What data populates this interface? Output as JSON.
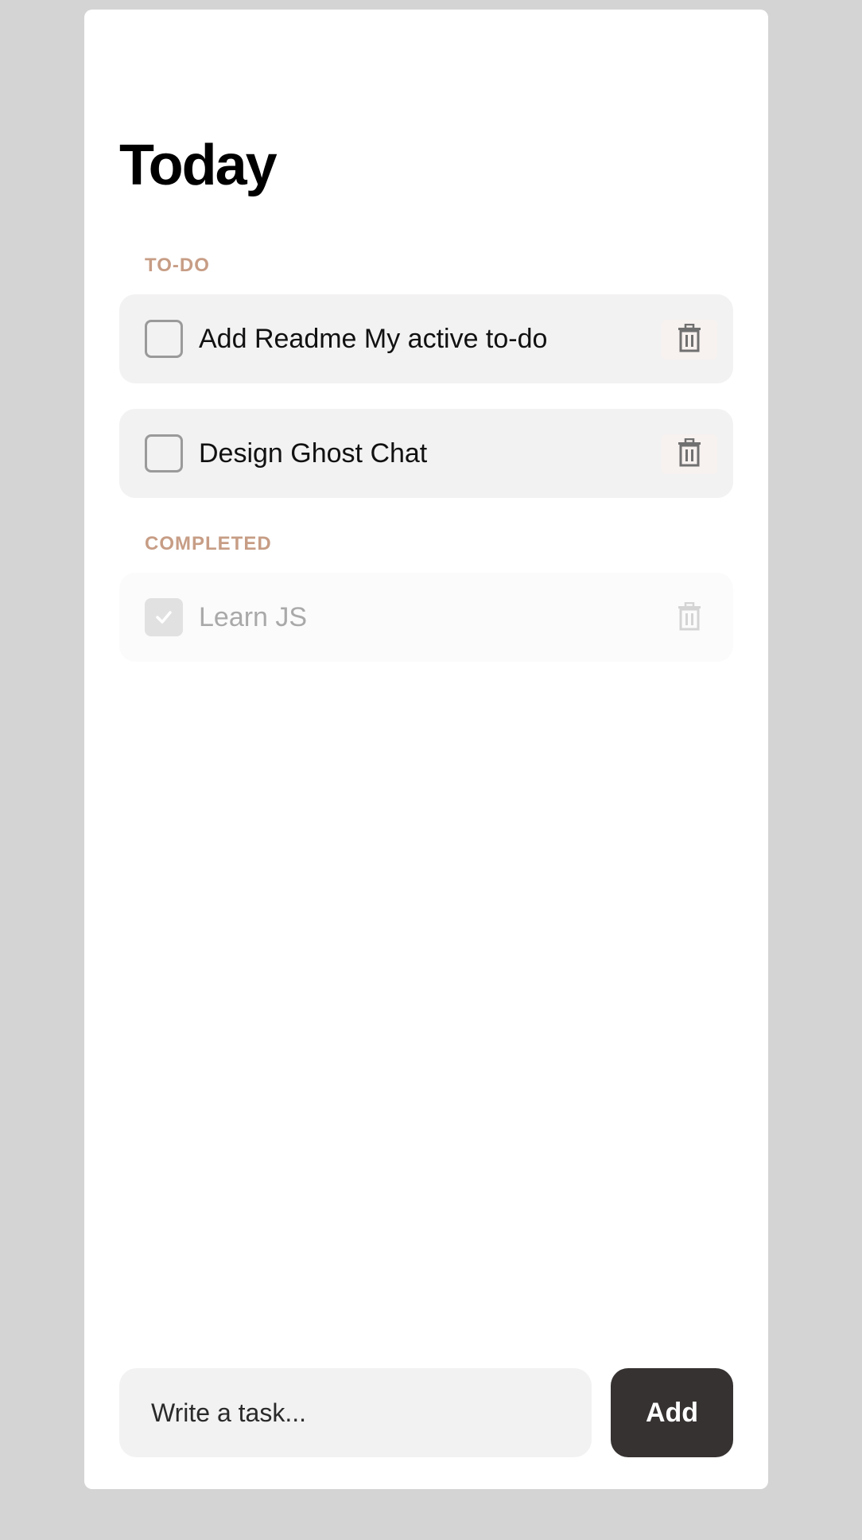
{
  "page": {
    "title": "Today"
  },
  "sections": {
    "todo_label": "TO-DO",
    "completed_label": "COMPLETED"
  },
  "tasks": {
    "todo": [
      {
        "label": "Add Readme My active to-do",
        "checked": false
      },
      {
        "label": "Design Ghost Chat",
        "checked": false
      }
    ],
    "completed": [
      {
        "label": "Learn JS",
        "checked": true
      }
    ]
  },
  "composer": {
    "placeholder": "Write a task...",
    "value": "",
    "add_label": "Add"
  },
  "icons": {
    "trash": "trash-icon",
    "checkmark": "checkmark-icon"
  },
  "colors": {
    "section_label": "#c79d85",
    "task_bg": "#f3f2f2",
    "add_button_bg": "#363231",
    "background": "#d4d4d4"
  }
}
